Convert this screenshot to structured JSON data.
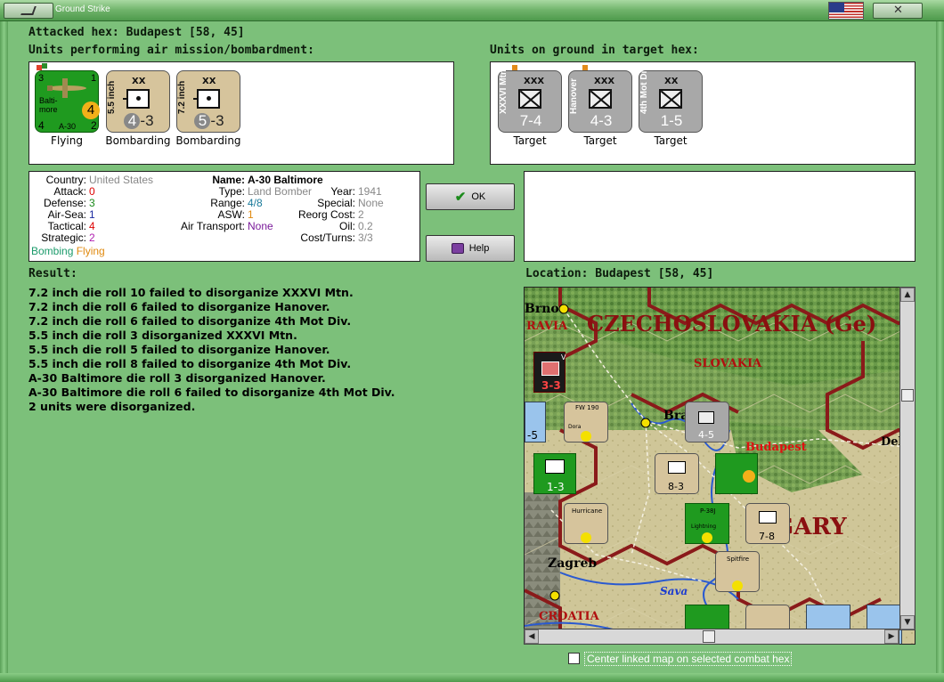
{
  "window": {
    "title": "Ground Strike"
  },
  "header": {
    "attacked_hex": "Attacked hex: Budapest  [58, 45]"
  },
  "air_section": {
    "label": "Units performing air mission/bombardment:",
    "units": [
      {
        "type": "air",
        "name": "Balti-more",
        "model": "A-30",
        "attack": "3",
        "top_right": "1",
        "defense": "4",
        "range": "2",
        "bomb": "4",
        "status": "Flying"
      },
      {
        "type": "artillery",
        "name": "5.5 inch",
        "size": "XX",
        "stats_a": "4",
        "stats_b": "3",
        "status": "Bombarding"
      },
      {
        "type": "artillery",
        "name": "7.2 inch",
        "size": "XX",
        "stats_a": "5",
        "stats_b": "3",
        "status": "Bombarding"
      }
    ]
  },
  "ground_section": {
    "label": "Units on ground in target hex:",
    "units": [
      {
        "name": "XXXVI Mtn",
        "size": "XXX",
        "stats": "7-4",
        "status": "Target"
      },
      {
        "name": "Hanover",
        "size": "XXX",
        "stats": "4-3",
        "status": "Target"
      },
      {
        "name": "4th Mot Div",
        "size": "XX",
        "stats": "1-5",
        "status": "Target"
      }
    ]
  },
  "info": {
    "country_k": "Country:",
    "country_v": "United States",
    "attack_k": "Attack:",
    "attack_v": "0",
    "defense_k": "Defense:",
    "defense_v": "3",
    "airsea_k": "Air-Sea:",
    "airsea_v": "1",
    "tactical_k": "Tactical:",
    "tactical_v": "4",
    "strategic_k": "Strategic:",
    "strategic_v": "2",
    "mission_a": "Bombing",
    "mission_b": "Flying",
    "name_k": "Name:",
    "name_v": "A-30 Baltimore",
    "type_k": "Type:",
    "type_v": "Land Bomber",
    "range_k": "Range:",
    "range_v": "4/8",
    "asw_k": "ASW:",
    "asw_v": "1",
    "airtransport_k": "Air Transport:",
    "airtransport_v": "None",
    "year_k": "Year:",
    "year_v": "1941",
    "special_k": "Special:",
    "special_v": "None",
    "reorg_k": "Reorg Cost:",
    "reorg_v": "2",
    "oil_k": "Oil:",
    "oil_v": "0.2",
    "cost_k": "Cost/Turns:",
    "cost_v": "3/3"
  },
  "buttons": {
    "ok": "OK",
    "help": "Help"
  },
  "result": {
    "label": "Result:",
    "lines": [
      "7.2 inch die roll 10 failed to disorganize XXXVI Mtn.",
      "7.2 inch die roll 6 failed to disorganize Hanover.",
      "7.2 inch die roll 6 failed to disorganize 4th Mot Div.",
      "5.5 inch die roll 3 disorganized XXXVI Mtn.",
      "5.5 inch die roll 5 failed to disorganize Hanover.",
      "5.5 inch die roll 8 failed to disorganize 4th Mot Div.",
      "A-30 Baltimore die roll 3 disorganized Hanover.",
      "A-30 Baltimore die roll 6 failed to disorganize 4th Mot Div.",
      "2 units were disorganized."
    ]
  },
  "location": {
    "label": "Location:  Budapest  [58, 45]"
  },
  "map": {
    "labels": {
      "brno": "Brno",
      "ravia": "RAVIA",
      "czech": "CZECHOSLOVAKIA (Ge)",
      "slovakia": "SLOVAKIA",
      "bra": "Bra",
      "budapest": "Budapest",
      "deb": "Deb",
      "hungary": "GARY",
      "zagreb": "Zagreb",
      "sava": "Sava",
      "croatia": "CROATIA"
    },
    "counters": {
      "fw190": "FW 190",
      "dora": "Dora",
      "hurricane": "Hurricane",
      "p38": "P-38J",
      "lightning": "Lightning",
      "spitfire": "Spitfire",
      "v_unit": "V",
      "s33": "3-3",
      "s45": "4-5",
      "s13": "1-3",
      "s83": "8-3",
      "s78": "7-8",
      "s15": "-5"
    }
  },
  "footer": {
    "center_map": "Center linked map on selected combat hex"
  },
  "colors": {
    "bg": "#7cc07a",
    "accent_red": "#cc0000",
    "air_green": "#1f9a1f",
    "counter_tan": "#d6c49c"
  }
}
